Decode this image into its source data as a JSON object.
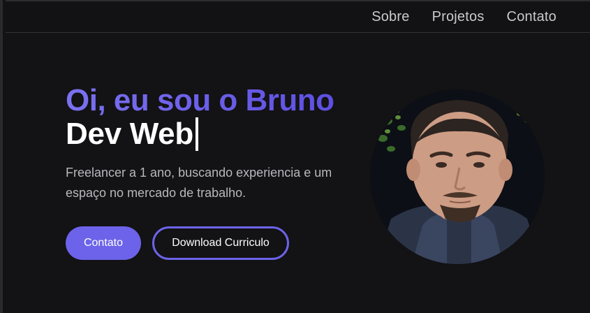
{
  "nav": {
    "items": [
      {
        "label": "Sobre"
      },
      {
        "label": "Projetos"
      },
      {
        "label": "Contato"
      }
    ]
  },
  "hero": {
    "greeting": "Oi, eu sou o Bruno",
    "role": "Dev Web",
    "description": "Freelancer a 1 ano, buscando experiencia e um espaço no mercado de trabalho.",
    "primary_button": "Contato",
    "secondary_button": "Download Curriculo"
  },
  "colors": {
    "background": "#131214",
    "accent": "#6c63ea",
    "accent_light": "#7a72f0",
    "text_primary": "#ffffff",
    "text_secondary": "#b8b8bf",
    "nav_text": "#c9c9cf"
  },
  "avatar": {
    "icon": "profile-photo"
  }
}
